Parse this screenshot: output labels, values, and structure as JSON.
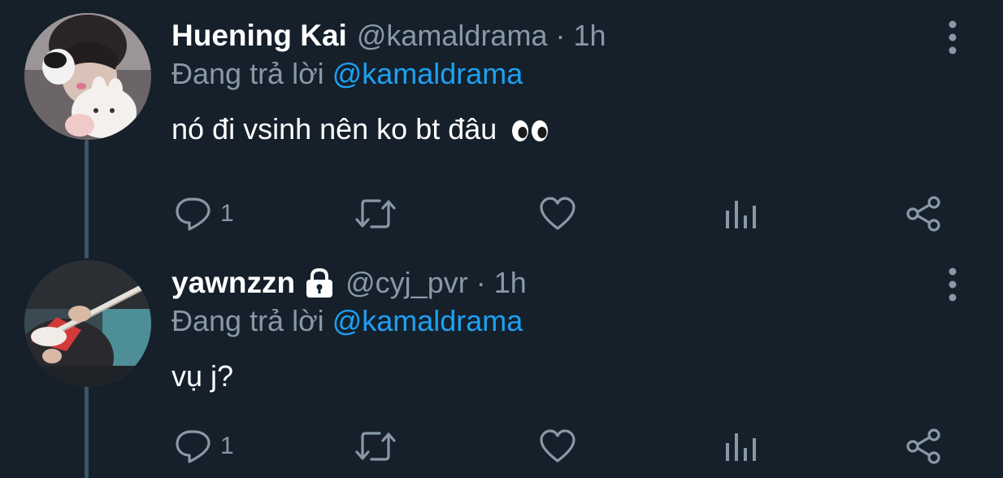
{
  "tweets": [
    {
      "display_name": "Huening Kai",
      "handle": "@kamaldrama",
      "separator": "·",
      "time": "1h",
      "reply_prefix": "Đang trả lời",
      "reply_mention": "@kamaldrama",
      "text": "nó đi vsinh nên ko bt đâu",
      "emoji": "eyes-emoji",
      "locked": false,
      "reply_count": "1"
    },
    {
      "display_name": "yawnzzn",
      "handle": "@cyj_pvr",
      "separator": "·",
      "time": "1h",
      "reply_prefix": "Đang trả lời",
      "reply_mention": "@kamaldrama",
      "text": "vụ j?",
      "locked": true,
      "reply_count": "1"
    }
  ],
  "colors": {
    "background": "#15202b",
    "primary_text": "#ffffff",
    "secondary_text": "#8899a6",
    "mention": "#1da1f2",
    "thread_line": "#3d5466"
  },
  "icons": {
    "reply": "reply-icon",
    "retweet": "retweet-icon",
    "like": "heart-icon",
    "analytics": "analytics-icon",
    "share": "share-icon",
    "more": "more-vertical-icon",
    "lock": "lock-icon"
  }
}
